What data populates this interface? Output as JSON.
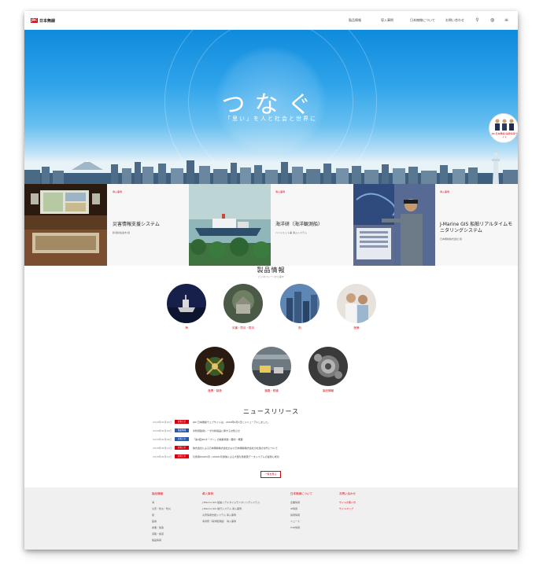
{
  "header": {
    "logo_text": "日本無線",
    "logo_mark": "JRC",
    "nav": [
      "製品情報",
      "導入事例",
      "日本無線について",
      "お問い合わせ"
    ],
    "icons": [
      "search-icon",
      "globe-icon",
      "menu-icon"
    ]
  },
  "hero": {
    "title": "つなぐ",
    "subtitle": "「思い」を人と社会と世界に",
    "badge_caption": "JRC日本無線 採用情報サイト"
  },
  "features": [
    {
      "tag": "導入事例",
      "title": "災害情報支援システム",
      "sub": "新潟県佐渡市 様"
    },
    {
      "tag": "導入事例",
      "title": "海洋研（海洋観測船）",
      "sub": "ハンドミット兼 導入システム"
    },
    {
      "tag": "導入事例",
      "title": "J-Marine GIS 船舶リアルタイムモニタリングシステム",
      "sub": "日本無線株式会社 様"
    }
  ],
  "products": {
    "title": "製品情報",
    "subtitle": "ビジネスシーンから探す",
    "items": [
      {
        "label": "海"
      },
      {
        "label": "災害・防災・防災"
      },
      {
        "label": "街"
      },
      {
        "label": "医療"
      },
      {
        "label": "産業・製造"
      },
      {
        "label": "道路・鉄道"
      },
      {
        "label": "製品情報"
      }
    ]
  },
  "news": {
    "title": "ニュースリリース",
    "items": [
      {
        "date": "2018年09月26日",
        "cat": "お知らせ",
        "text": "JRC 日本無線ウェブサイトは、2018年9月1日にリニューアルしました。"
      },
      {
        "date": "2018年09月26日",
        "cat": "製品情報",
        "text": "水防用監視レーダの新製品に関するお知らせ"
      },
      {
        "date": "2018年09月06日",
        "cat": "お知らせ",
        "text": "「第4回JRCオープン」の開催報告 / 要約・概要"
      },
      {
        "date": "2018年09月01日",
        "cat": "お知らせ",
        "text": "株式会社による日本無線株式会社および日本無線株式会社の社長の交代について"
      },
      {
        "date": "2018年09月01日",
        "cat": "お知らせ",
        "text": "気象用60GHz帯 / 90GHz帯通信による大型気象観測データシステムの運用に成功"
      }
    ],
    "more": "一覧を見る"
  },
  "footer": {
    "columns": [
      {
        "heading": "製品情報",
        "items": [
          "海",
          "災害・防災・防災",
          "街",
          "医療",
          "産業・製造",
          "道路・鉄道",
          "製品情報"
        ]
      },
      {
        "heading": "導入事例",
        "items": [
          "J-Marine GIS 船舶リアルタイムモニタリングシステム",
          "J-Marine GIS 航行システム 導入事例",
          "災害情報支援システム 導入事例",
          "海洋研（海洋観測船） 導入事例"
        ]
      },
      {
        "heading": "日本無線について",
        "items": [
          "企業情報",
          "IR情報",
          "採用情報",
          "ニュース",
          "CSR情報"
        ]
      },
      {
        "heading": "お問い合わせ",
        "items": [
          "サイトの使い方",
          "サイトマップ"
        ]
      }
    ]
  },
  "colors": {
    "brand_red": "#d7000f",
    "sky_blue": "#2ea3ea"
  }
}
